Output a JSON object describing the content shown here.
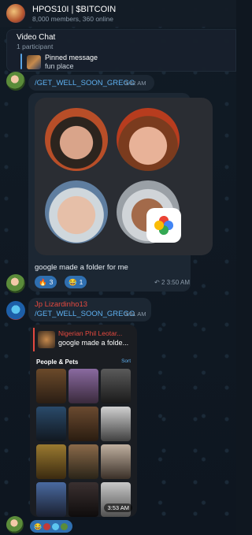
{
  "header": {
    "title": "HPOS10I | $BITCOIN",
    "subtitle": "8,000 members, 360 online"
  },
  "video_chat": {
    "title": "Video Chat",
    "participants": "1 participant"
  },
  "pinned": {
    "label": "Pinned message",
    "text": "fun place"
  },
  "messages": [
    {
      "command": "/GET_WELL_SOON_GREGG",
      "time": "3:42 AM"
    },
    {
      "caption": "google made a folder for me",
      "reactions": [
        {
          "emoji": "🔥",
          "count": "3"
        },
        {
          "emoji": "😂",
          "count": "1"
        }
      ],
      "replies": "2",
      "time": "3:50 AM"
    },
    {
      "sender": "Jp Lizardinho13",
      "command": "/GET_WELL_SOON_GREGG",
      "time": "3:51 AM"
    },
    {
      "quote_name": "Nigerian Phil Leotar...",
      "quote_text": "google made a folde...",
      "section": "People & Pets",
      "sort": "Sort",
      "time": "3:53 AM"
    }
  ],
  "colors": {
    "link": "#5eb0f0",
    "sender": "#e5493f",
    "bubble": "#1c2733"
  }
}
